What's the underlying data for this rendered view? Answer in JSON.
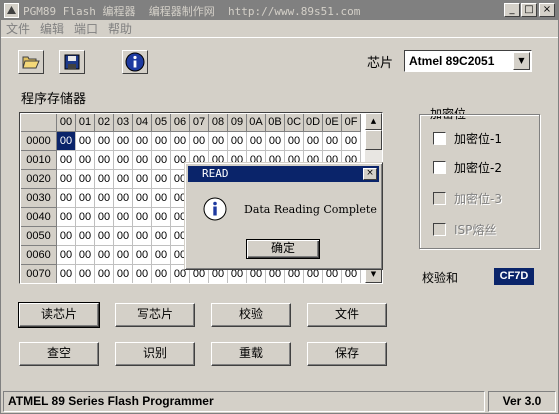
{
  "window": {
    "title": "PGM89 Flash 编程器  编程器制作网  http://www.89s51.com",
    "controls": [
      "_",
      "□",
      "×"
    ]
  },
  "menu": [
    "文件",
    "编辑",
    "端口",
    "帮助"
  ],
  "toolbar": {
    "icons": [
      "open-folder-icon",
      "save-disk-icon",
      "info-icon"
    ]
  },
  "chip": {
    "label": "芯片",
    "selected": "Atmel  89C2051"
  },
  "memory": {
    "label": "程序存储器",
    "columns": [
      "00",
      "01",
      "02",
      "03",
      "04",
      "05",
      "06",
      "07",
      "08",
      "09",
      "0A",
      "0B",
      "0C",
      "0D",
      "0E",
      "0F"
    ],
    "rows": [
      "0000",
      "0010",
      "0020",
      "0030",
      "0040",
      "0050",
      "0060",
      "0070"
    ],
    "cell_value": "00",
    "selected_cell": {
      "row": 0,
      "col": 0
    }
  },
  "encryption": {
    "title": "加密位",
    "items": [
      {
        "label": "加密位-1",
        "enabled": true
      },
      {
        "label": "加密位-2",
        "enabled": true
      },
      {
        "label": "加密位-3",
        "enabled": false
      },
      {
        "label": "ISP熔丝",
        "enabled": false
      }
    ]
  },
  "checksum": {
    "label": "校验和",
    "value": "CF7D"
  },
  "buttons": {
    "read_chip": "读芯片",
    "write_chip": "写芯片",
    "verify": "校验",
    "file": "文件",
    "blank_check": "查空",
    "identify": "识别",
    "reload": "重载",
    "save": "保存"
  },
  "status": {
    "main": "ATMEL 89 Series Flash Programmer",
    "version": "Ver 3.0"
  },
  "dialog": {
    "title": "READ",
    "message": "Data Reading Complete",
    "ok": "确定"
  }
}
